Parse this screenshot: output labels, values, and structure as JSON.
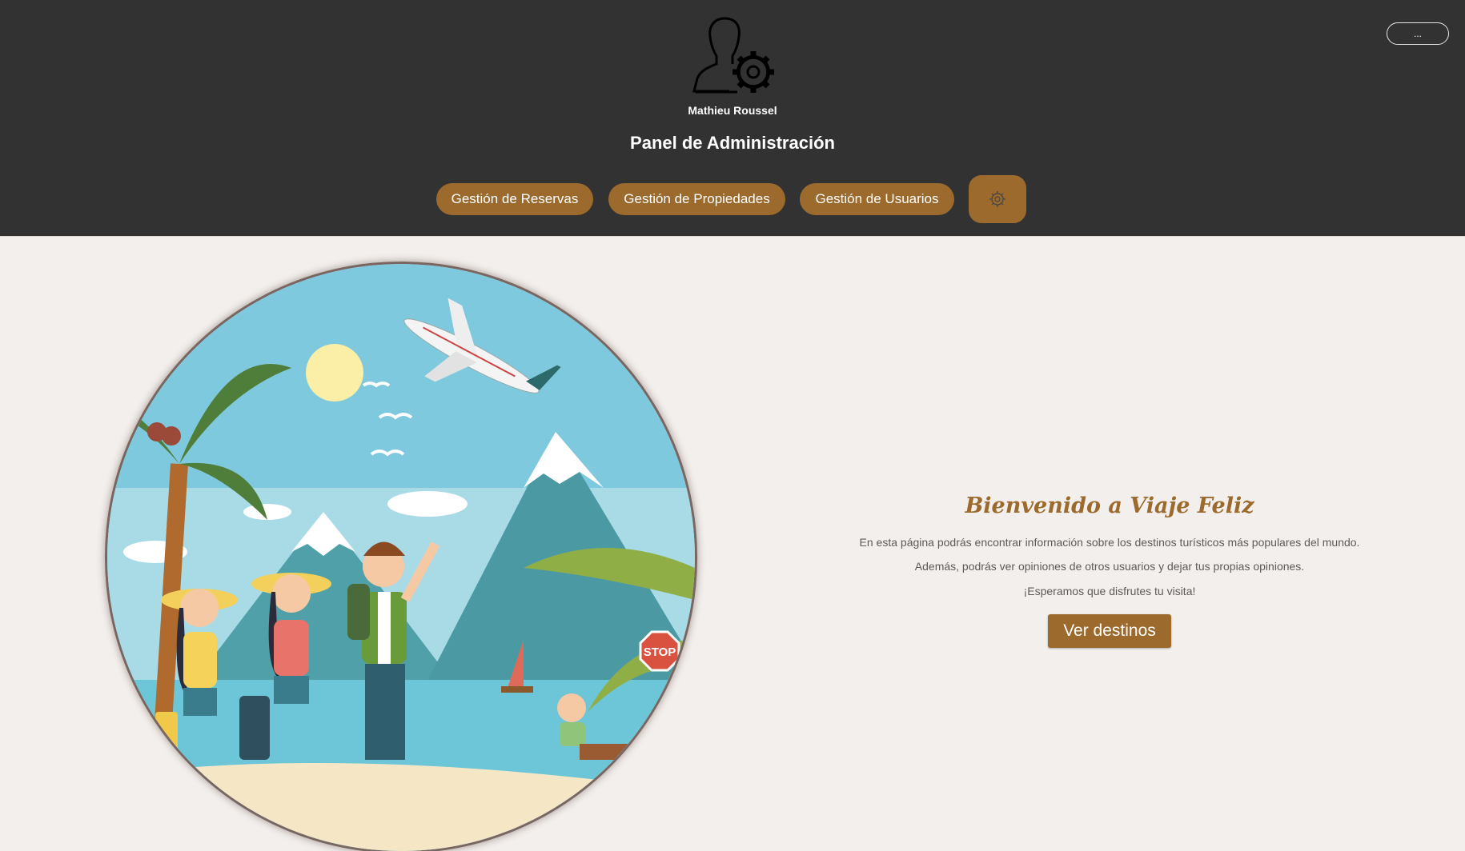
{
  "header": {
    "menu_label": "...",
    "user_name": "Mathieu Roussel",
    "title": "Panel de Administración",
    "nav": [
      {
        "label": "Gestión de Reservas"
      },
      {
        "label": "Gestión de Propiedades"
      },
      {
        "label": "Gestión de Usuarios"
      }
    ],
    "settings_icon": "gear-icon",
    "avatar_icon": "user-admin-icon"
  },
  "hero": {
    "image_sign": "STOP"
  },
  "welcome": {
    "title": "Bienvenido a Viaje Feliz",
    "lines": [
      "En esta página podrás encontrar información sobre los destinos turísticos más populares del mundo.",
      "Además, podrás ver opiniones de otros usuarios y dejar tus propias opiniones.",
      "¡Esperamos que disfrutes tu visita!"
    ],
    "cta_label": "Ver destinos"
  },
  "colors": {
    "header_bg": "#323232",
    "accent": "#9b6a2c",
    "page_bg": "#f3efec"
  }
}
